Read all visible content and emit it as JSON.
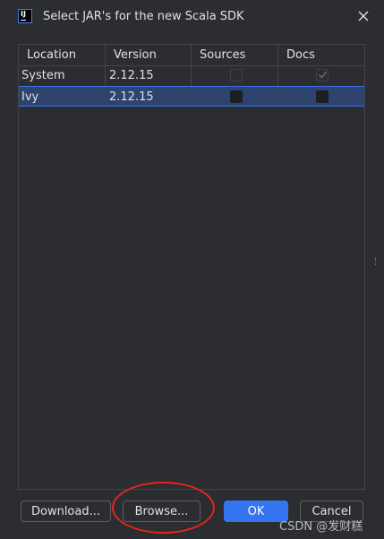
{
  "window": {
    "title": "Select JAR's for the new Scala SDK",
    "icon": "intellij-icon",
    "icon_text": "IJ"
  },
  "table": {
    "columns": [
      "Location",
      "Version",
      "Sources",
      "Docs"
    ],
    "rows": [
      {
        "location": "System",
        "version": "2.12.15",
        "sources": false,
        "docs": true
      },
      {
        "location": "Ivy",
        "version": "2.12.15",
        "sources": false,
        "docs": false
      }
    ],
    "selected_row": 1
  },
  "buttons": {
    "download": "Download...",
    "browse": "Browse...",
    "ok": "OK",
    "cancel": "Cancel"
  },
  "watermark": "CSDN @发财糕",
  "colors": {
    "background": "#2b2d30",
    "accent": "#3574f0",
    "selection": "#2e436e",
    "annotation": "#e8241c"
  }
}
